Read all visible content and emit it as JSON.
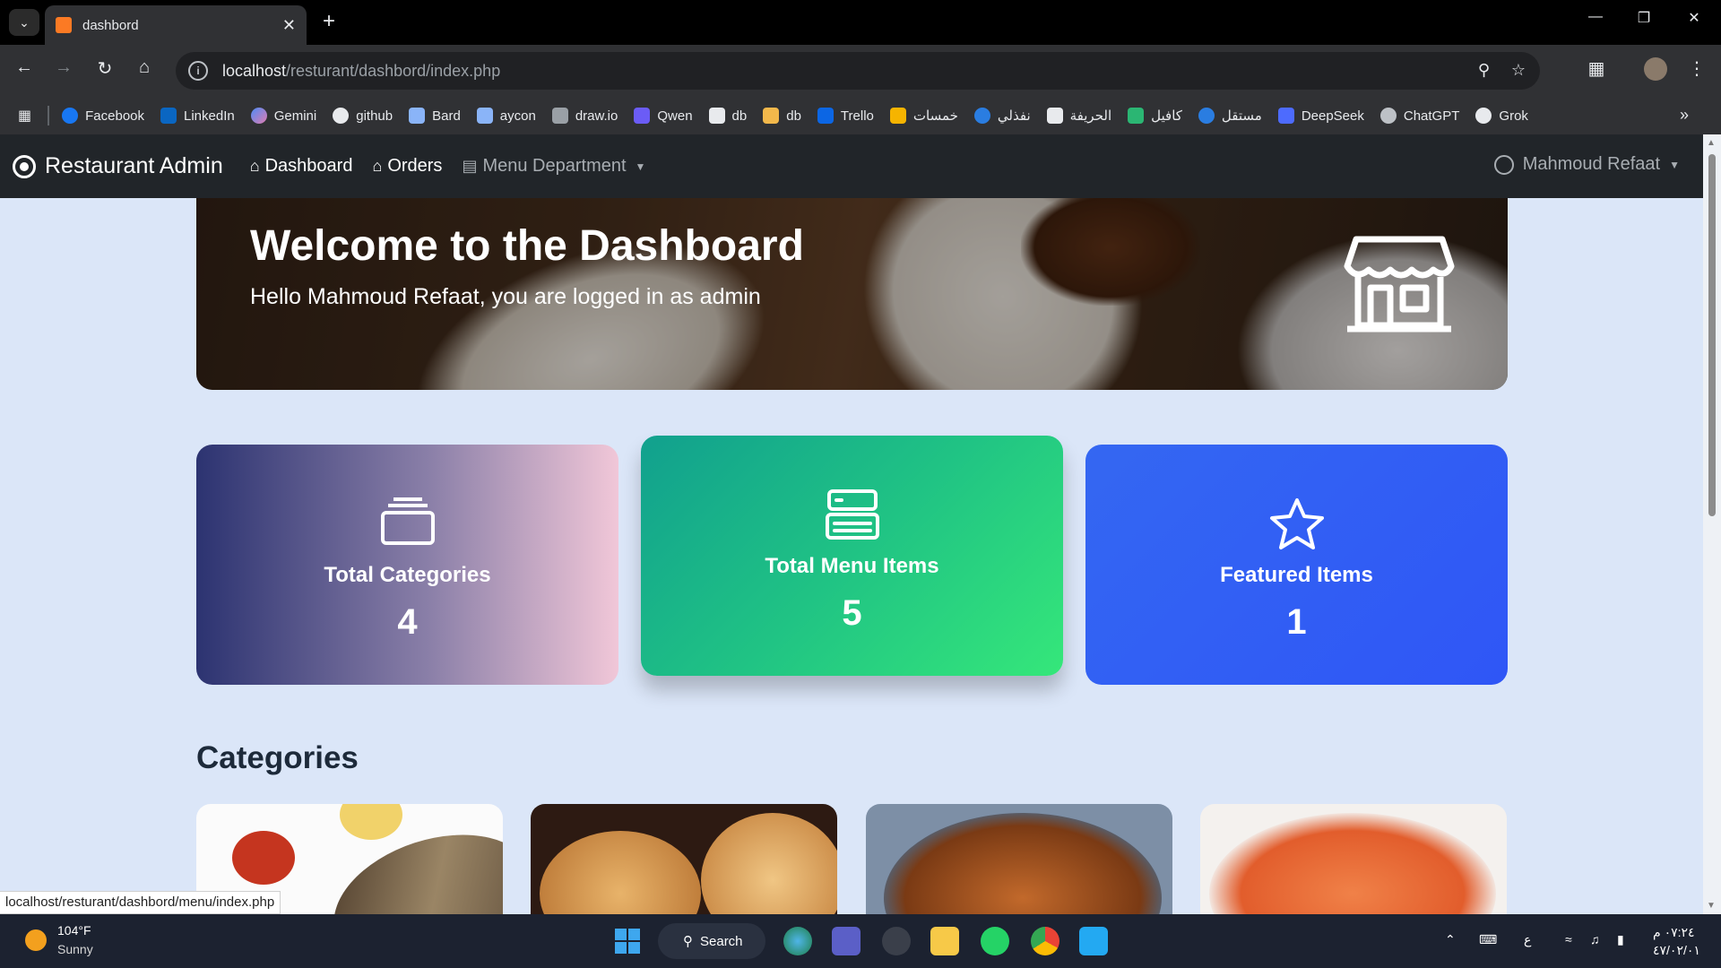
{
  "browser": {
    "tab_title": "dashbord",
    "url_host": "localhost",
    "url_path": "/resturant/dashbord/index.php",
    "bookmarks": [
      "Facebook",
      "LinkedIn",
      "Gemini",
      "github",
      "Bard",
      "aycon",
      "draw.io",
      "Qwen",
      "db",
      "db",
      "Trello",
      "خمسات",
      "نفذلي",
      "الحريفة",
      "كافيل",
      "مستقل",
      "DeepSeek",
      "ChatGPT",
      "Grok"
    ],
    "status_url": "localhost/resturant/dashbord/menu/index.php"
  },
  "navbar": {
    "brand": "Restaurant Admin",
    "dashboard": "Dashboard",
    "orders": "Orders",
    "menu_department": "Menu Department",
    "user": "Mahmoud Refaat"
  },
  "hero": {
    "title": "Welcome to the Dashboard",
    "subtitle": "Hello Mahmoud Refaat, you are logged in as admin"
  },
  "stats": [
    {
      "label": "Total Categories",
      "value": "4",
      "icon": "layers-icon"
    },
    {
      "label": "Total Menu Items",
      "value": "5",
      "icon": "server-icon"
    },
    {
      "label": "Featured Items",
      "value": "1",
      "icon": "star-icon"
    }
  ],
  "categories_title": "Categories",
  "taskbar": {
    "temp": "104°F",
    "condition": "Sunny",
    "search": "Search",
    "time": "٠٧:٢٤ م",
    "date": "٤٧/٠٢/٠١",
    "lang": "ع"
  }
}
